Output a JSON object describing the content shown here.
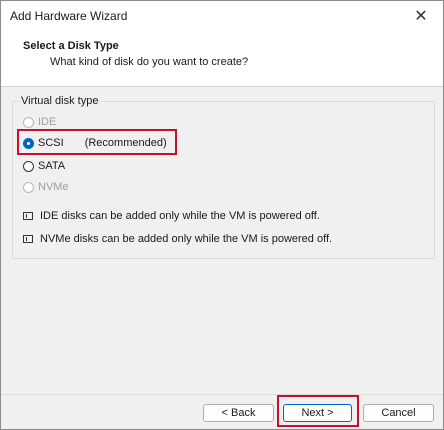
{
  "window": {
    "title": "Add Hardware Wizard",
    "close_glyph": "✕"
  },
  "header": {
    "title": "Select a Disk Type",
    "subtitle": "What kind of disk do you want to create?"
  },
  "group": {
    "label": "Virtual disk type",
    "options": [
      {
        "label": "IDE",
        "checked": false,
        "disabled": true
      },
      {
        "label": "SCSI",
        "checked": true,
        "disabled": false,
        "suffix": "(Recommended)"
      },
      {
        "label": "SATA",
        "checked": false,
        "disabled": false
      },
      {
        "label": "NVMe",
        "checked": false,
        "disabled": true
      }
    ],
    "notes": [
      "IDE disks can be added only while the VM is powered off.",
      "NVMe disks can be added only while the VM is powered off."
    ]
  },
  "buttons": {
    "back": "< Back",
    "next": "Next >",
    "cancel": "Cancel"
  },
  "colors": {
    "highlight": "#c8102e",
    "accent": "#0067c0"
  }
}
